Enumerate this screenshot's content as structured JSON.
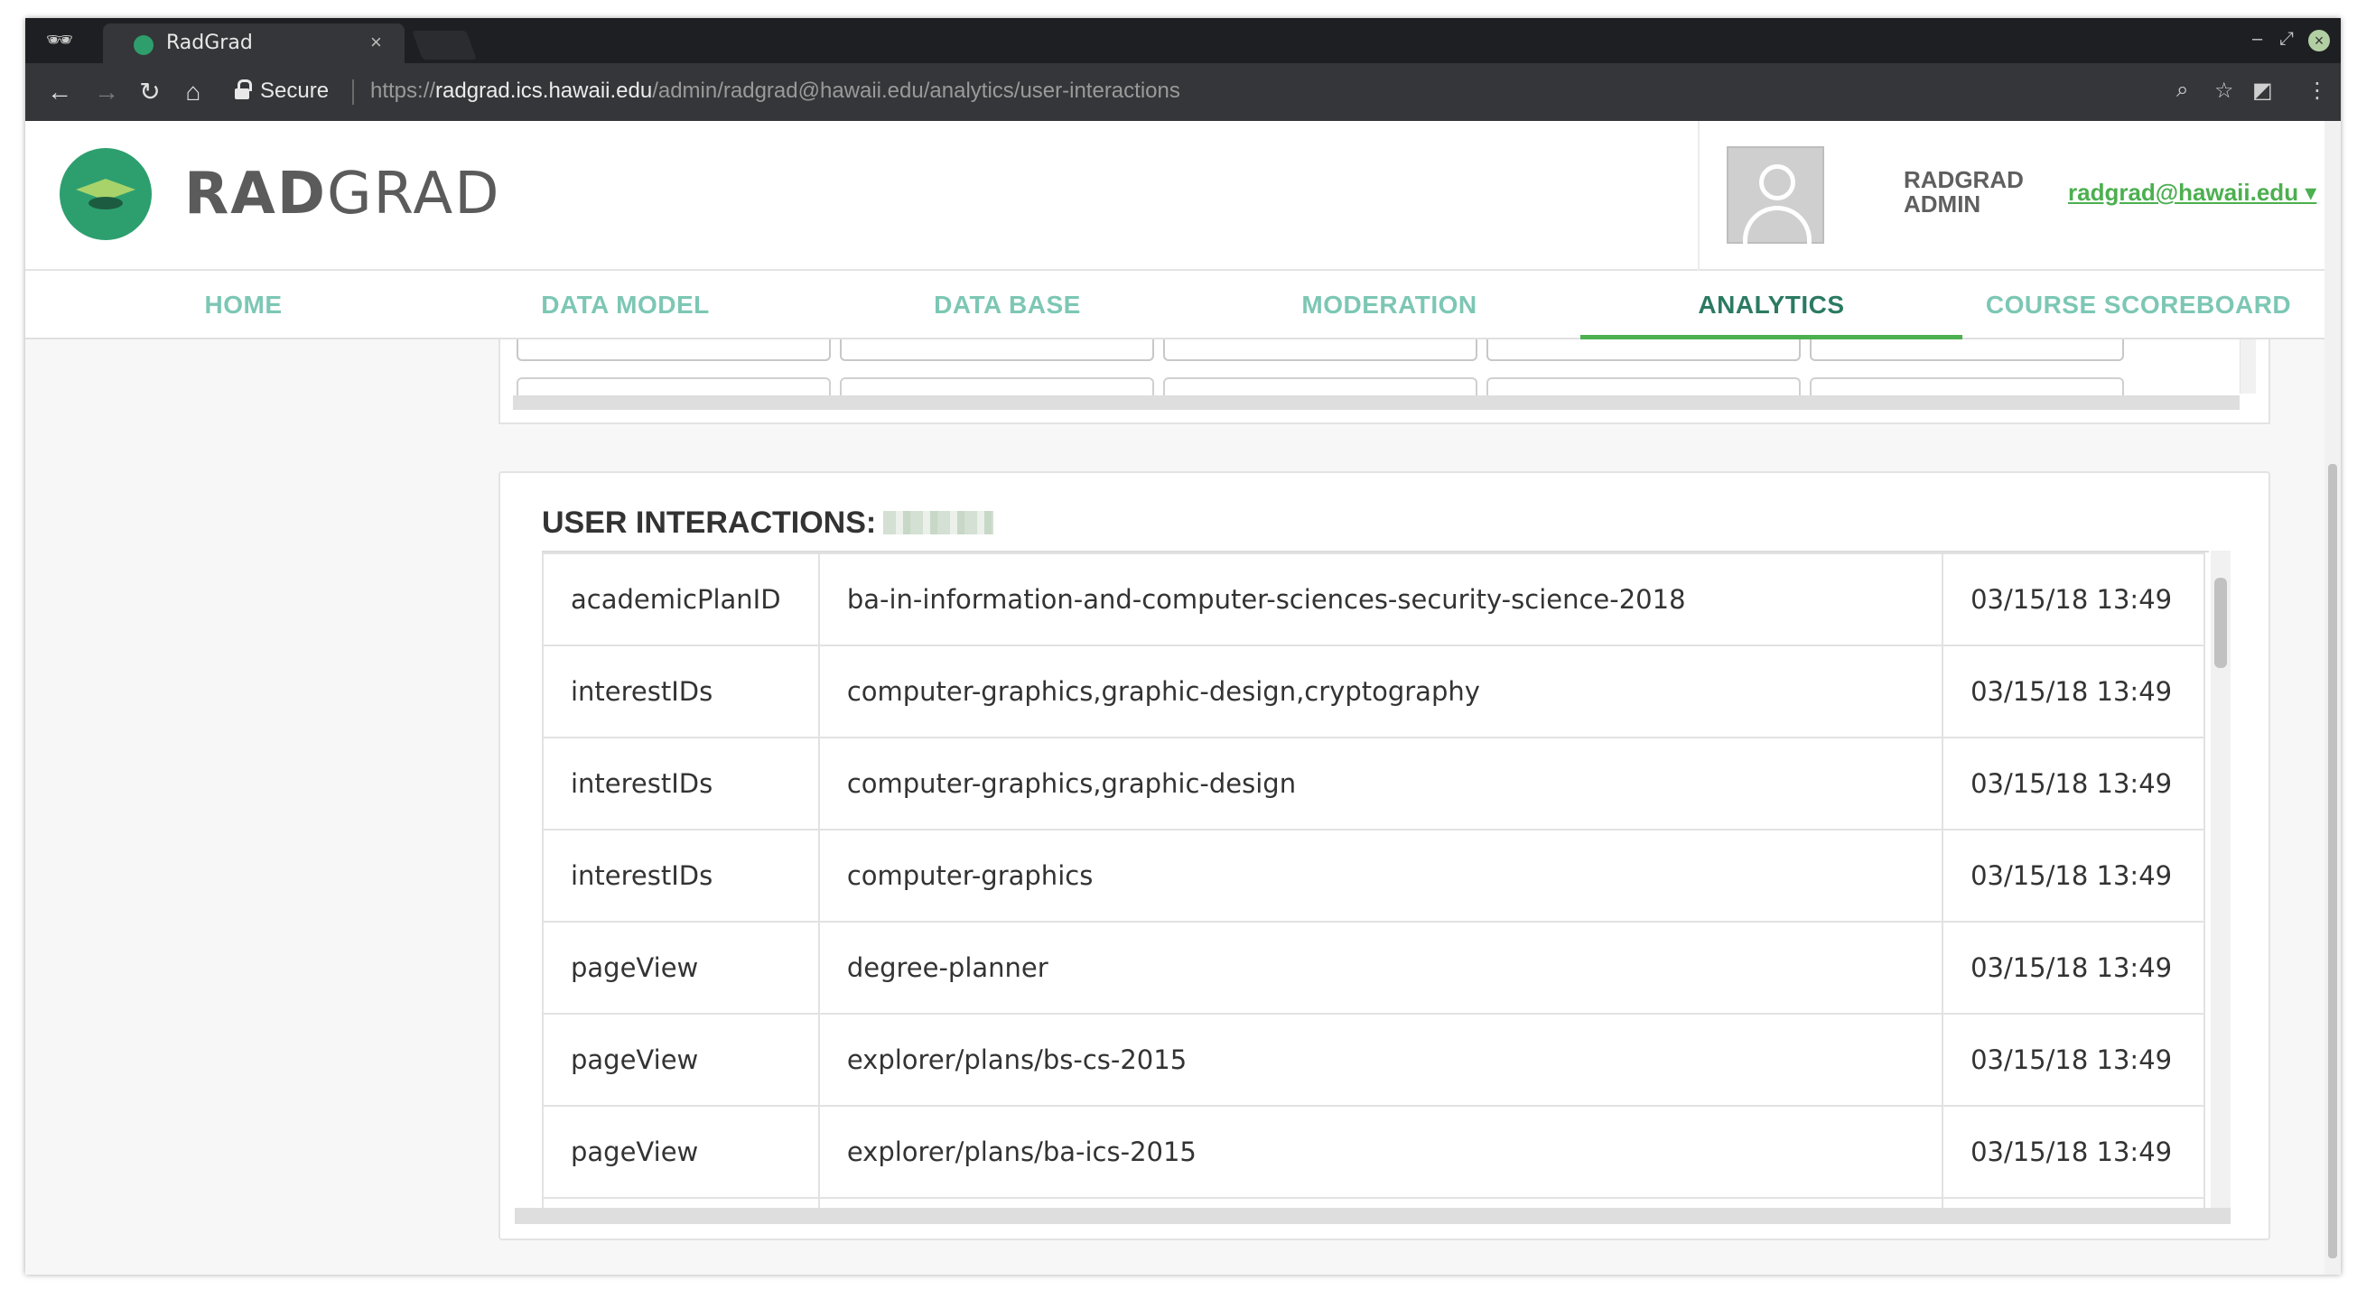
{
  "browser": {
    "tab_title": "RadGrad",
    "tab_close": "×",
    "secure_label": "Secure",
    "url_scheme": "https://",
    "url_host": "radgrad.ics.hawaii.edu",
    "url_path": "/admin/radgrad@hawaii.edu/analytics/user-interactions",
    "minimize": "–",
    "restore": "⤢",
    "close": "×",
    "back": "←",
    "forward": "→",
    "reload": "↻",
    "home": "⌂",
    "zoom": "⌕",
    "star": "☆",
    "extension": "◩",
    "menu": "⋮",
    "incognito": "🕶"
  },
  "header": {
    "brand_bold": "RAD",
    "brand_light": "GRAD",
    "role_line1": "RADGRAD",
    "role_line2": "ADMIN",
    "user_email": "radgrad@hawaii.edu ▾"
  },
  "nav": {
    "items": [
      {
        "label": "HOME"
      },
      {
        "label": "DATA MODEL"
      },
      {
        "label": "DATA BASE"
      },
      {
        "label": "MODERATION"
      },
      {
        "label": "ANALYTICS"
      },
      {
        "label": "COURSE SCOREBOARD"
      }
    ],
    "active": "ANALYTICS"
  },
  "interactions": {
    "title": "USER INTERACTIONS:",
    "rows": [
      {
        "type": "academicPlanID",
        "value": "ba-in-information-and-computer-sciences-security-science-2018",
        "time": "03/15/18 13:49"
      },
      {
        "type": "interestIDs",
        "value": "computer-graphics,graphic-design,cryptography",
        "time": "03/15/18 13:49"
      },
      {
        "type": "interestIDs",
        "value": "computer-graphics,graphic-design",
        "time": "03/15/18 13:49"
      },
      {
        "type": "interestIDs",
        "value": "computer-graphics",
        "time": "03/15/18 13:49"
      },
      {
        "type": "pageView",
        "value": "degree-planner",
        "time": "03/15/18 13:49"
      },
      {
        "type": "pageView",
        "value": "explorer/plans/bs-cs-2015",
        "time": "03/15/18 13:49"
      },
      {
        "type": "pageView",
        "value": "explorer/plans/ba-ics-2015",
        "time": "03/15/18 13:49"
      }
    ]
  },
  "colors": {
    "brand_green": "#2d9f6f",
    "nav_text": "#7cc7b4",
    "nav_active": "#2b7a61",
    "active_underline": "#4caf50",
    "link_green": "#4caf50"
  }
}
